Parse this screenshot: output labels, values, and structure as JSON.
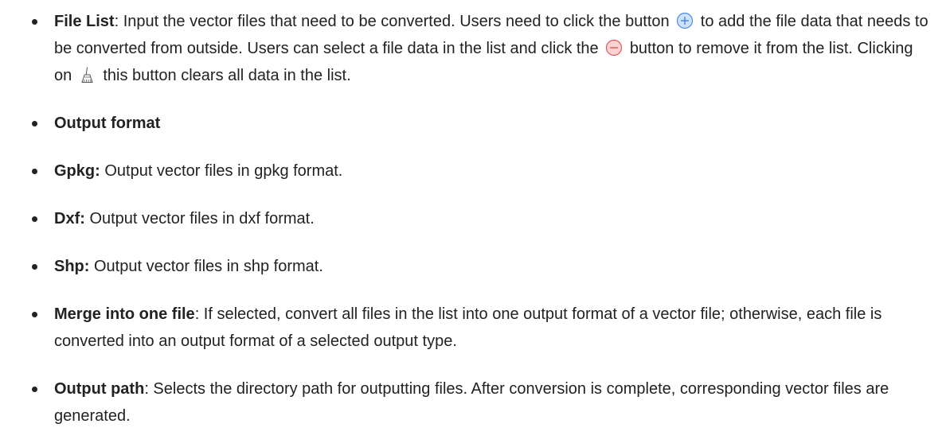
{
  "items": [
    {
      "term": "File List",
      "sep": ": ",
      "text_a": "Input the vector files that need to be converted. Users need to click the button",
      "text_b": "to add the file data that needs to be converted from outside. Users can select a file data in the list and click the",
      "text_c": "button to remove it from the list. Clicking on",
      "text_d": "this button clears all data in the list.",
      "icons": [
        "add-circle-icon",
        "remove-circle-icon",
        "broom-clear-icon"
      ]
    },
    {
      "term": "Output format",
      "text": ""
    },
    {
      "term": "Gpkg:",
      "text": " Output vector files in gpkg format."
    },
    {
      "term": "Dxf:",
      "text": " Output vector files in dxf format."
    },
    {
      "term": "Shp:",
      "text": " Output vector files in shp format."
    },
    {
      "term": "Merge into one file",
      "text": ": If selected, convert all files in the list into one output format of a vector file; otherwise, each file is converted into an output format of a selected output type."
    },
    {
      "term": "Output path",
      "text": ": Selects the directory path for outputting files. After conversion is complete, corresponding vector files are generated."
    }
  ],
  "colors": {
    "text": "#222222",
    "add_icon_fill": "#cfe1fb",
    "add_icon_stroke": "#4a8be8",
    "remove_icon_fill": "#fbd3d3",
    "remove_icon_stroke": "#e05c5c"
  }
}
